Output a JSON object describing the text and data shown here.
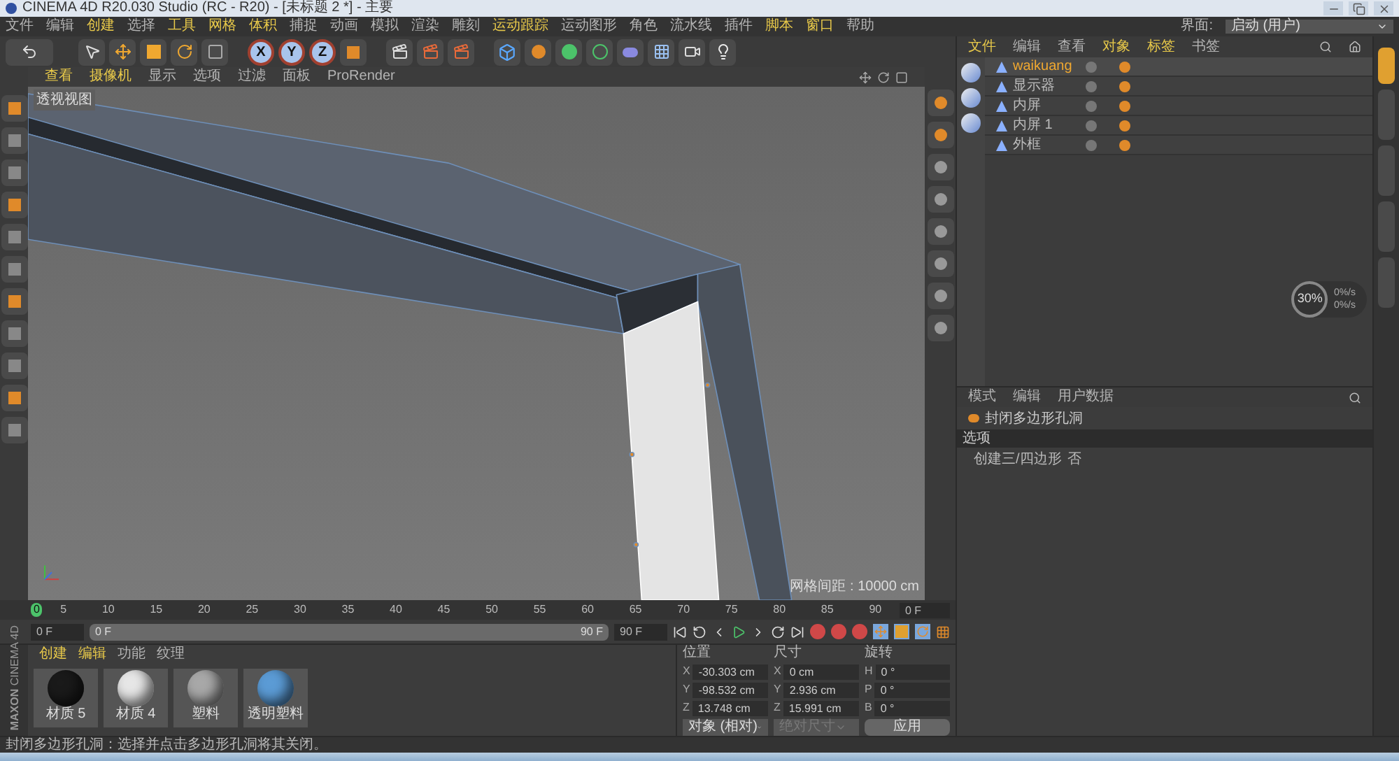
{
  "window": {
    "title": "CINEMA 4D R20.030 Studio (RC - R20) - [未标题 2 *] - 主要"
  },
  "menu": [
    {
      "label": "文件",
      "highlighted": false
    },
    {
      "label": "编辑",
      "highlighted": false
    },
    {
      "label": "创建",
      "highlighted": true
    },
    {
      "label": "选择",
      "highlighted": false
    },
    {
      "label": "工具",
      "highlighted": true
    },
    {
      "label": "网格",
      "highlighted": true
    },
    {
      "label": "体积",
      "highlighted": true
    },
    {
      "label": "捕捉",
      "highlighted": false
    },
    {
      "label": "动画",
      "highlighted": false
    },
    {
      "label": "模拟",
      "highlighted": false
    },
    {
      "label": "渲染",
      "highlighted": false
    },
    {
      "label": "雕刻",
      "highlighted": false
    },
    {
      "label": "运动跟踪",
      "highlighted": true
    },
    {
      "label": "运动图形",
      "highlighted": false
    },
    {
      "label": "角色",
      "highlighted": false
    },
    {
      "label": "流水线",
      "highlighted": false
    },
    {
      "label": "插件",
      "highlighted": false
    },
    {
      "label": "脚本",
      "highlighted": true
    },
    {
      "label": "窗口",
      "highlighted": true
    },
    {
      "label": "帮助",
      "highlighted": false
    }
  ],
  "layout_selector": {
    "label": "界面:",
    "value": "启动 (用户)"
  },
  "axis_buttons": [
    {
      "label": "X",
      "selected": true
    },
    {
      "label": "Y",
      "selected": true
    },
    {
      "label": "Z",
      "selected": true
    }
  ],
  "viewport": {
    "menu": [
      {
        "label": "查看",
        "highlighted": true
      },
      {
        "label": "摄像机",
        "highlighted": true
      },
      {
        "label": "显示",
        "highlighted": false
      },
      {
        "label": "选项",
        "highlighted": false
      },
      {
        "label": "过滤",
        "highlighted": false
      },
      {
        "label": "面板",
        "highlighted": false
      },
      {
        "label": "ProRender",
        "highlighted": false
      }
    ],
    "view_name": "透视视图",
    "grid_spacing": "网格间距 : 10000 cm"
  },
  "object_manager": {
    "menu": [
      {
        "label": "文件",
        "highlighted": true
      },
      {
        "label": "编辑",
        "highlighted": false
      },
      {
        "label": "查看",
        "highlighted": false
      },
      {
        "label": "对象",
        "highlighted": true
      },
      {
        "label": "标签",
        "highlighted": true
      },
      {
        "label": "书签",
        "highlighted": false
      }
    ],
    "objects": [
      {
        "name": "waikuang",
        "selected": true
      },
      {
        "name": "显示器",
        "selected": false
      },
      {
        "name": "内屏",
        "selected": false
      },
      {
        "name": "内屏 1",
        "selected": false
      },
      {
        "name": "外框",
        "selected": false
      }
    ]
  },
  "hud": {
    "percent": "30%",
    "rates": [
      "0%/s",
      "0%/s"
    ]
  },
  "attribute_manager": {
    "menu": [
      {
        "label": "模式",
        "highlighted": false
      },
      {
        "label": "编辑",
        "highlighted": false
      },
      {
        "label": "用户数据",
        "highlighted": false
      }
    ],
    "title": "封闭多边形孔洞",
    "section": "选项",
    "fields": [
      {
        "label": "创建三/四边形",
        "value": "否"
      }
    ]
  },
  "timeline": {
    "playhead": "0",
    "ticks": [
      "5",
      "10",
      "15",
      "20",
      "25",
      "30",
      "35",
      "40",
      "45",
      "50",
      "55",
      "60",
      "65",
      "70",
      "75",
      "80",
      "85",
      "90"
    ],
    "current_frame": "0 F"
  },
  "playback": {
    "start": "0 F",
    "range_start": "0 F",
    "range_end": "90 F",
    "end": "90 F"
  },
  "logo": {
    "brand": "MAXON",
    "product": "CINEMA 4D"
  },
  "material_manager": {
    "menu": [
      {
        "label": "创建",
        "highlighted": true
      },
      {
        "label": "编辑",
        "highlighted": true
      },
      {
        "label": "功能",
        "highlighted": false
      },
      {
        "label": "纹理",
        "highlighted": false
      }
    ],
    "materials": [
      {
        "name": "材质 5",
        "color": "#1a1a1a"
      },
      {
        "name": "材质 4",
        "color": "#e6e6e6"
      },
      {
        "name": "塑料",
        "color": "#a8a8a8"
      },
      {
        "name": "透明塑料",
        "color": "#5b9bd5"
      }
    ]
  },
  "coordinates": {
    "headers": [
      "位置",
      "尺寸",
      "旋转"
    ],
    "rows": [
      {
        "position_axis": "X",
        "position": "-30.303 cm",
        "size_axis": "X",
        "size": "0 cm",
        "rotation_axis": "H",
        "rotation": "0 °"
      },
      {
        "position_axis": "Y",
        "position": "-98.532 cm",
        "size_axis": "Y",
        "size": "2.936 cm",
        "rotation_axis": "P",
        "rotation": "0 °"
      },
      {
        "position_axis": "Z",
        "position": "13.748 cm",
        "size_axis": "Z",
        "size": "15.991 cm",
        "rotation_axis": "B",
        "rotation": "0 °"
      }
    ],
    "mode": "对象 (相对)",
    "size_mode": {
      "value": "绝对尺寸",
      "disabled": true
    },
    "apply": "应用"
  },
  "side_tabs": [
    {
      "selected": true
    },
    {
      "selected": false
    },
    {
      "selected": false
    },
    {
      "selected": false
    },
    {
      "selected": false
    }
  ],
  "status_bar": "封闭多边形孔洞：选择并点击多边形孔洞将其关闭。"
}
